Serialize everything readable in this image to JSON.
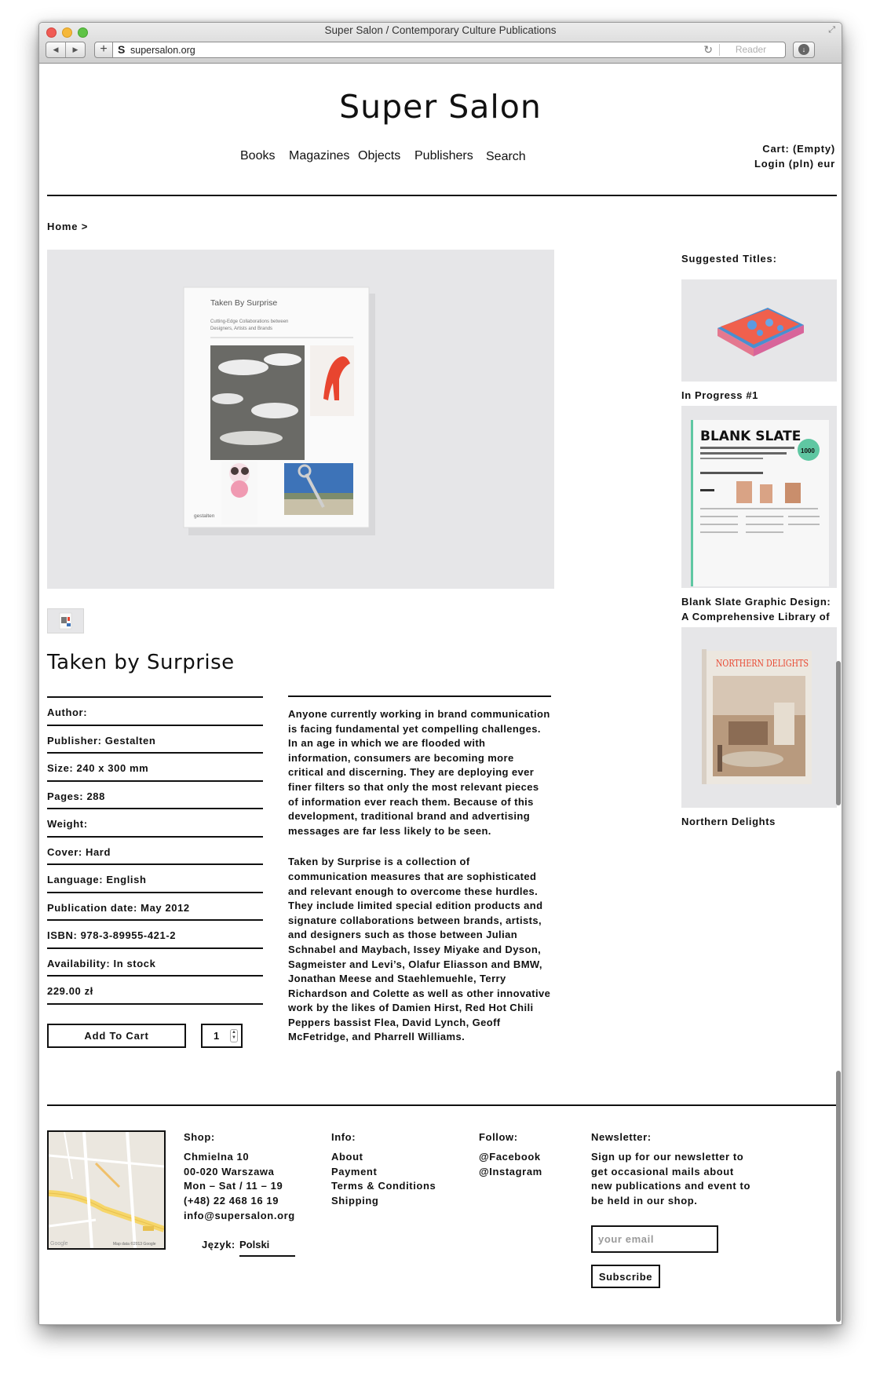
{
  "browser": {
    "window_title": "Super Salon / Contemporary Culture Publications",
    "url": "supersalon.org",
    "reader_label": "Reader",
    "favicon": "S",
    "back_icon": "◀",
    "forward_icon": "▶",
    "new_tab_icon": "+",
    "reload_icon": "↻",
    "download_icon": "↓",
    "resize_icon": "⤢"
  },
  "site": {
    "logo": "Super Salon",
    "nav": [
      "Books",
      "Magazines",
      "Objects",
      "Publishers",
      "Search"
    ],
    "cart_label": "Cart: (Empty)",
    "login_label": "Login",
    "currency_pln": "(pln)",
    "currency_eur": "eur"
  },
  "breadcrumb": "Home >",
  "product": {
    "title": "Taken by Surprise",
    "cover_title": "Taken By Surprise",
    "cover_subtitle_1": "Cutting-Edge Collaborations between",
    "cover_subtitle_2": "Designers, Artists and Brands",
    "cover_publisher": "gestalten",
    "specs": [
      "Author:",
      "Publisher: Gestalten",
      "Size: 240 x 300 mm",
      "Pages: 288",
      "Weight:",
      "Cover: Hard",
      "Language: English",
      "Publication date: May 2012",
      "ISBN: 978-3-89955-421-2",
      "Availability: In stock",
      "229.00 zł"
    ],
    "add_to_cart": "Add To Cart",
    "quantity": "1",
    "description": [
      "Anyone currently working in brand communication is facing fundamental yet compelling challenges. In an age in which we are flooded with information, consumers are becoming more critical and discerning. They are deploying ever finer filters so that only the most relevant pieces of information ever reach them. Because of this development, traditional brand and advertising messages are far less likely to be seen.",
      "Taken by Surprise is a collection of communication measures that are sophisticated and relevant enough to overcome these hurdles. They include limited special edition products and signature collaborations between brands, artists, and designers such as those between Julian Schnabel and Maybach, Issey Miyake and Dyson, Sagmeister and Levi’s, Olafur Eliasson and BMW, Jonathan Meese and Staehlemuehle, Terry Richardson and Colette as well as other innovative work by the likes of Damien Hirst, Red Hot Chili Peppers bassist Flea, David Lynch, Geoff McFetridge, and Pharrell Williams."
    ]
  },
  "suggested": {
    "heading": "Suggested Titles:",
    "items": [
      {
        "caption": "In Progress #1"
      },
      {
        "caption": "Blank Slate Graphic Design: A Comprehensive Library of Photographic Templates",
        "cover_text": "BLANK SLATE",
        "badge": "1000"
      },
      {
        "caption": "Northern Delights",
        "cover_text": "NORTHERN DELIGHTS"
      }
    ]
  },
  "footer": {
    "map_credit": "Map data ©2013 Google",
    "shop": {
      "heading": "Shop:",
      "lines": [
        "Chmielna 10",
        "00-020 Warszawa",
        "Mon – Sat / 11 – 19",
        "(+48) 22 468 16 19",
        "info@supersalon.org"
      ]
    },
    "language_label": "Język:",
    "language_value": "Polski",
    "info": {
      "heading": "Info:",
      "links": [
        "About",
        "Payment",
        "Terms & Conditions",
        "Shipping"
      ]
    },
    "follow": {
      "heading": "Follow:",
      "links": [
        "@Facebook",
        "@Instagram"
      ]
    },
    "newsletter": {
      "heading": "Newsletter:",
      "text": "Sign up for our newsletter to get occasional mails about new publications and event to be held in our shop.",
      "placeholder": "your email",
      "button": "Subscribe"
    }
  },
  "colors": {
    "accent_red": "#e8452f",
    "image_bg": "#e6e6e8",
    "rule": "#111111"
  }
}
